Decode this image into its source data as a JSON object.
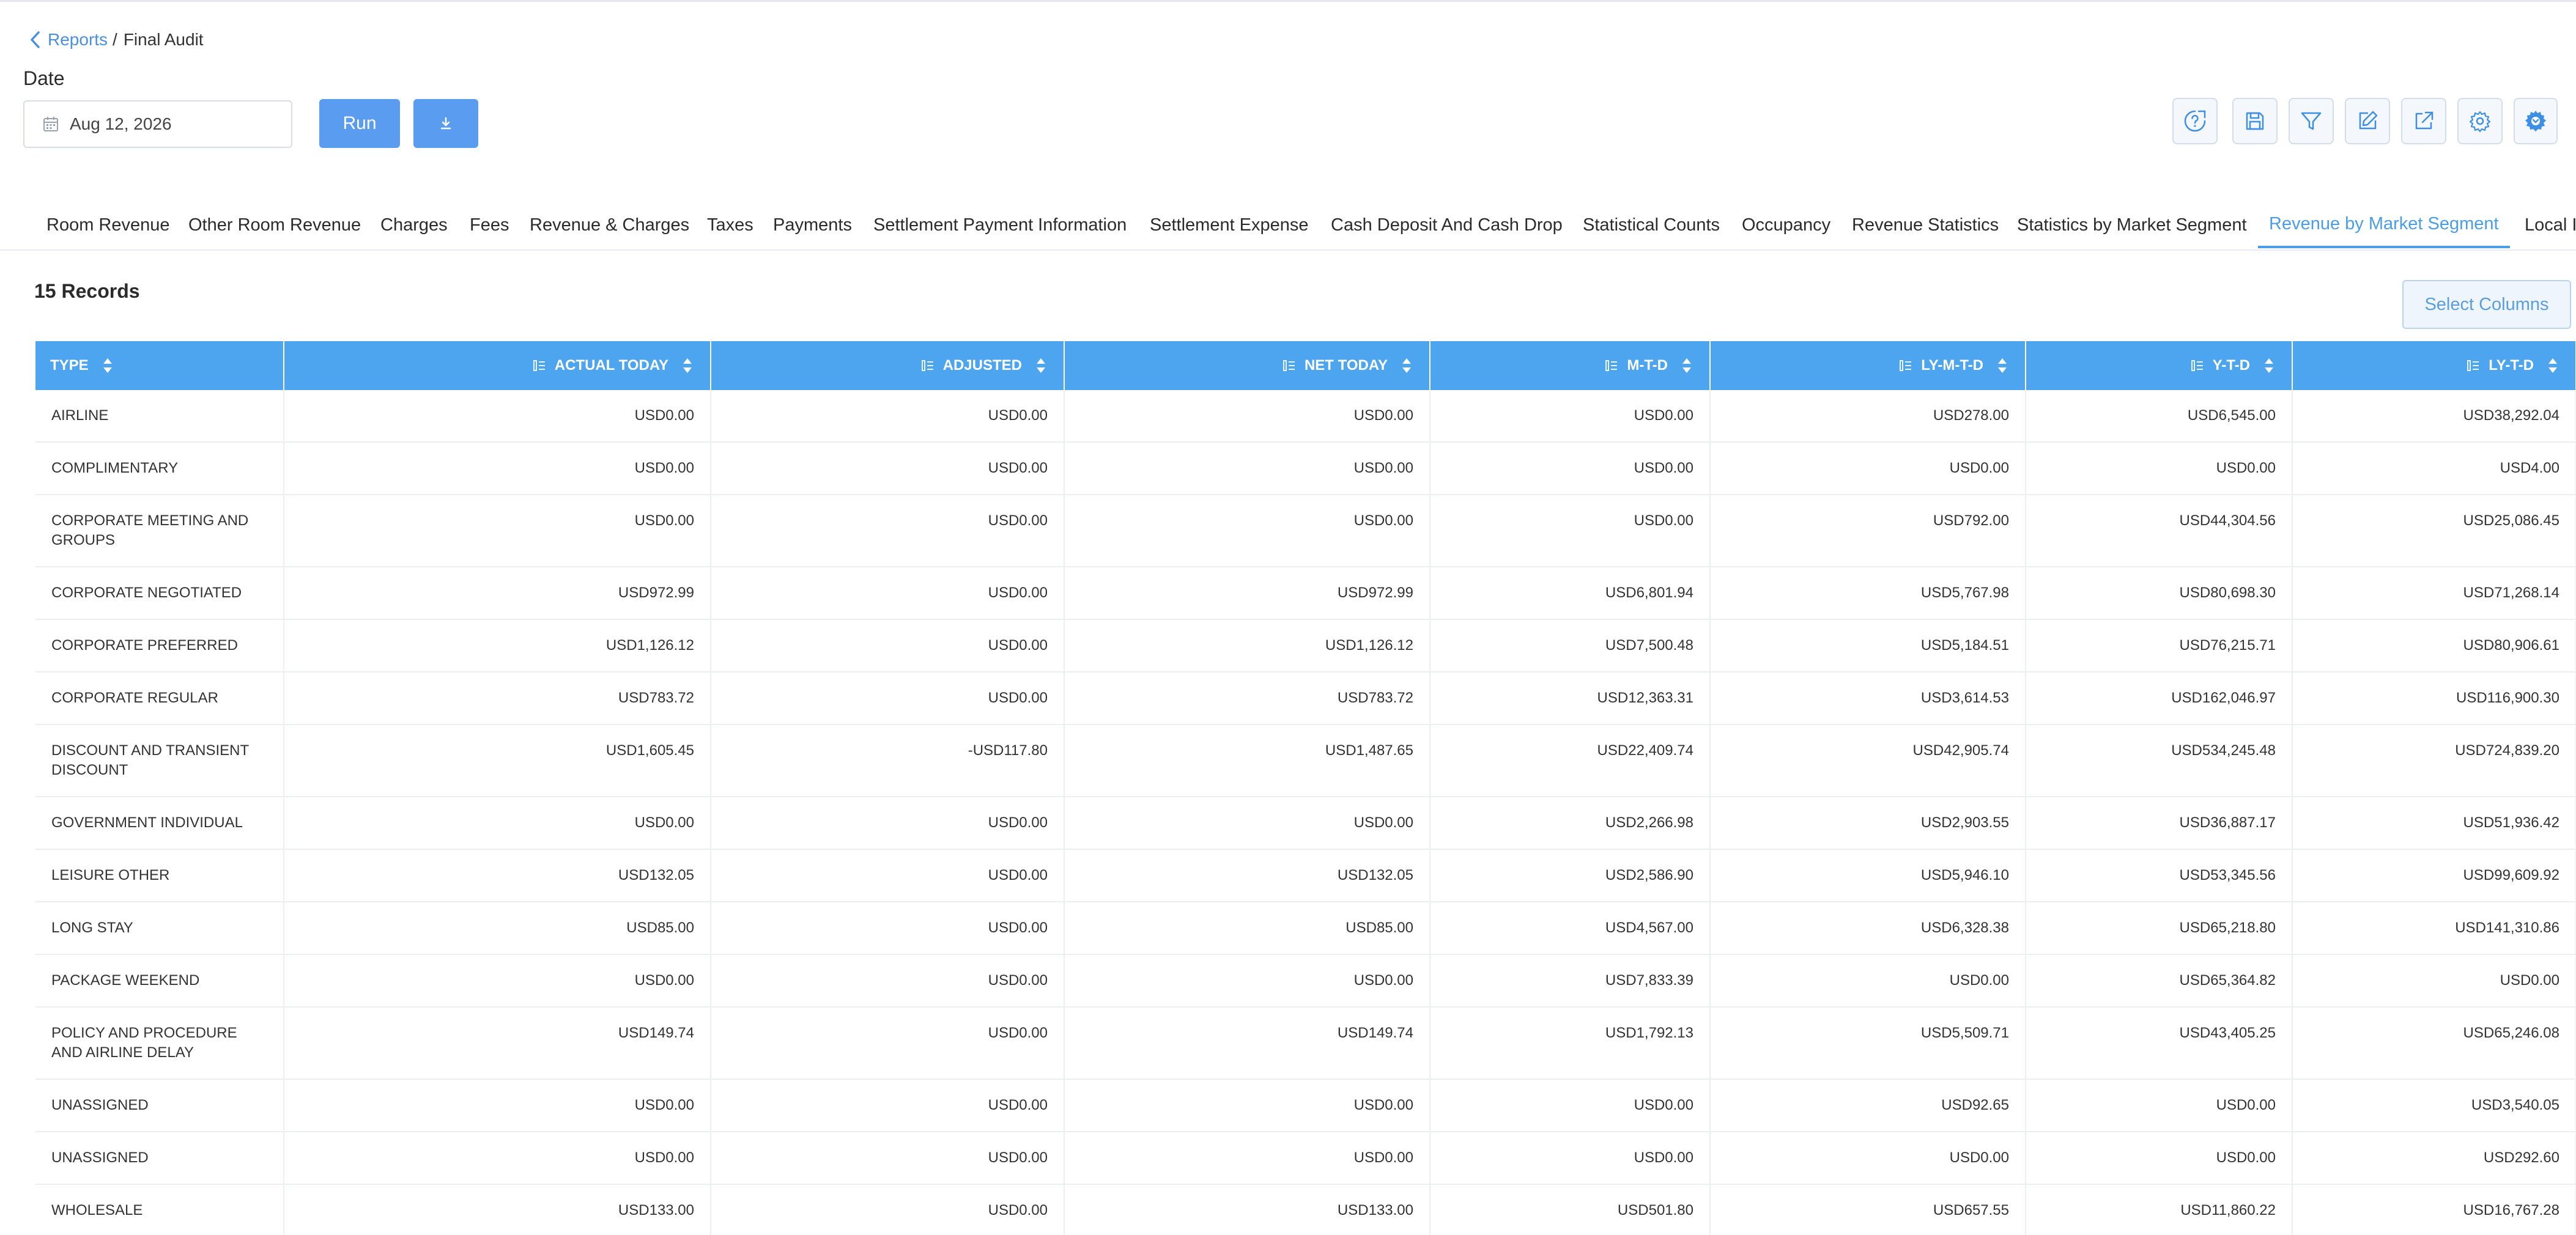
{
  "breadcrumb": {
    "parent": "Reports",
    "separator": "/",
    "current": "Final Audit"
  },
  "date_field": {
    "label": "Date",
    "value": "Aug 12, 2026"
  },
  "actions": {
    "run_label": "Run"
  },
  "toolbar_icons": [
    "help-icon",
    "save-icon",
    "filter-icon",
    "edit-icon",
    "export-icon",
    "settings-icon",
    "advanced-settings-icon"
  ],
  "tabs": [
    "Room Revenue",
    "Other Room Revenue",
    "Charges",
    "Fees",
    "Revenue & Charges",
    "Taxes",
    "Payments",
    "Settlement Payment Information",
    "Settlement Expense",
    "Cash Deposit And Cash Drop",
    "Statistical Counts",
    "Occupancy",
    "Revenue Statistics",
    "Statistics by Market Segment",
    "Revenue by Market Segment",
    "Local I"
  ],
  "active_tab": "Revenue by Market Segment",
  "records_label": "15 Records",
  "select_columns_label": "Select Columns",
  "colors": {
    "accent": "#4ea5ef",
    "button": "#5a9cf0",
    "active_tab": "#4a9ee8"
  },
  "table": {
    "columns": [
      "TYPE",
      "ACTUAL TODAY",
      "ADJUSTED",
      "NET TODAY",
      "M-T-D",
      "LY-M-T-D",
      "Y-T-D",
      "LY-T-D"
    ],
    "rows": [
      [
        "AIRLINE",
        "USD0.00",
        "USD0.00",
        "USD0.00",
        "USD0.00",
        "USD278.00",
        "USD6,545.00",
        "USD38,292.04"
      ],
      [
        "COMPLIMENTARY",
        "USD0.00",
        "USD0.00",
        "USD0.00",
        "USD0.00",
        "USD0.00",
        "USD0.00",
        "USD4.00"
      ],
      [
        "CORPORATE MEETING AND GROUPS",
        "USD0.00",
        "USD0.00",
        "USD0.00",
        "USD0.00",
        "USD792.00",
        "USD44,304.56",
        "USD25,086.45"
      ],
      [
        "CORPORATE NEGOTIATED",
        "USD972.99",
        "USD0.00",
        "USD972.99",
        "USD6,801.94",
        "USD5,767.98",
        "USD80,698.30",
        "USD71,268.14"
      ],
      [
        "CORPORATE PREFERRED",
        "USD1,126.12",
        "USD0.00",
        "USD1,126.12",
        "USD7,500.48",
        "USD5,184.51",
        "USD76,215.71",
        "USD80,906.61"
      ],
      [
        "CORPORATE REGULAR",
        "USD783.72",
        "USD0.00",
        "USD783.72",
        "USD12,363.31",
        "USD3,614.53",
        "USD162,046.97",
        "USD116,900.30"
      ],
      [
        "DISCOUNT AND TRANSIENT DISCOUNT",
        "USD1,605.45",
        "-USD117.80",
        "USD1,487.65",
        "USD22,409.74",
        "USD42,905.74",
        "USD534,245.48",
        "USD724,839.20"
      ],
      [
        "GOVERNMENT INDIVIDUAL",
        "USD0.00",
        "USD0.00",
        "USD0.00",
        "USD2,266.98",
        "USD2,903.55",
        "USD36,887.17",
        "USD51,936.42"
      ],
      [
        "LEISURE OTHER",
        "USD132.05",
        "USD0.00",
        "USD132.05",
        "USD2,586.90",
        "USD5,946.10",
        "USD53,345.56",
        "USD99,609.92"
      ],
      [
        "LONG STAY",
        "USD85.00",
        "USD0.00",
        "USD85.00",
        "USD4,567.00",
        "USD6,328.38",
        "USD65,218.80",
        "USD141,310.86"
      ],
      [
        "PACKAGE WEEKEND",
        "USD0.00",
        "USD0.00",
        "USD0.00",
        "USD7,833.39",
        "USD0.00",
        "USD65,364.82",
        "USD0.00"
      ],
      [
        "POLICY AND PROCEDURE AND AIRLINE DELAY",
        "USD149.74",
        "USD0.00",
        "USD149.74",
        "USD1,792.13",
        "USD5,509.71",
        "USD43,405.25",
        "USD65,246.08"
      ],
      [
        "UNASSIGNED",
        "USD0.00",
        "USD0.00",
        "USD0.00",
        "USD0.00",
        "USD92.65",
        "USD0.00",
        "USD3,540.05"
      ],
      [
        "UNASSIGNED",
        "USD0.00",
        "USD0.00",
        "USD0.00",
        "USD0.00",
        "USD0.00",
        "USD0.00",
        "USD292.60"
      ],
      [
        "WHOLESALE",
        "USD133.00",
        "USD0.00",
        "USD133.00",
        "USD501.80",
        "USD657.55",
        "USD11,860.22",
        "USD16,767.28"
      ]
    ]
  }
}
